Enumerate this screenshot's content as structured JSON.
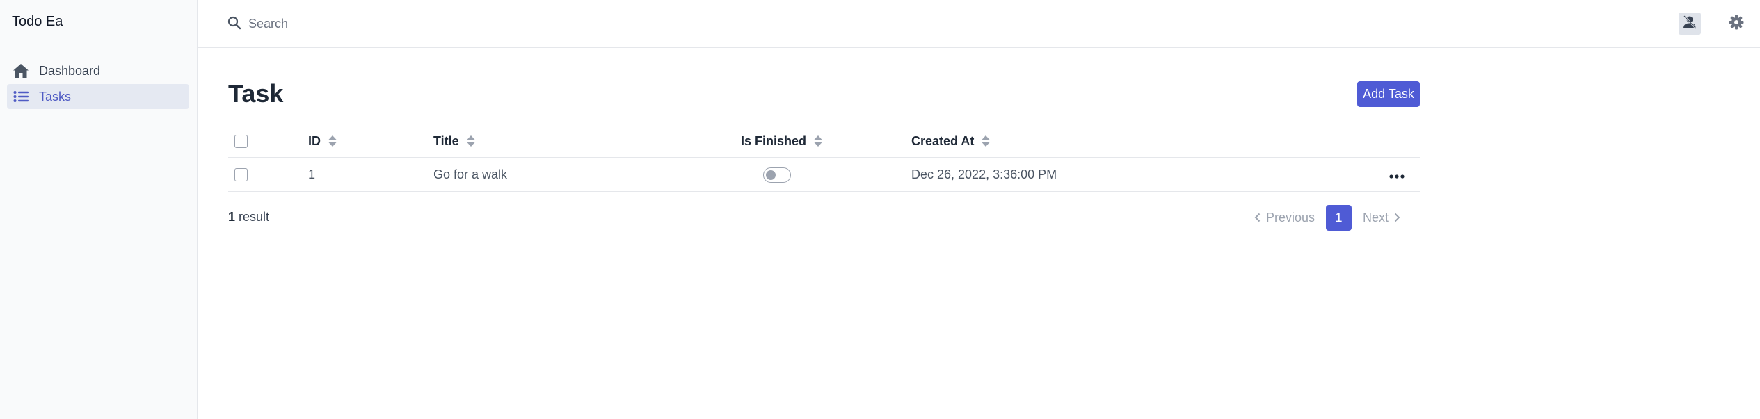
{
  "app": {
    "title": "Todo Ea"
  },
  "sidebar": {
    "items": [
      {
        "label": "Dashboard",
        "icon": "home-icon",
        "active": false
      },
      {
        "label": "Tasks",
        "icon": "list-icon",
        "active": true
      }
    ]
  },
  "topbar": {
    "search_placeholder": "Search",
    "search_value": "",
    "icons": [
      "avatar-icon",
      "gear-icon"
    ]
  },
  "main": {
    "title": "Task",
    "add_button": "Add Task"
  },
  "table": {
    "columns": [
      "ID",
      "Title",
      "Is Finished",
      "Created At"
    ],
    "rows": [
      {
        "id": "1",
        "title": "Go for a walk",
        "is_finished": false,
        "created_at": "Dec 26, 2022, 3:36:00 PM"
      }
    ]
  },
  "footer": {
    "result_count": "1",
    "result_label": "result",
    "previous": "Previous",
    "next": "Next",
    "current_page": "1"
  },
  "colors": {
    "accent": "#4f5bd5",
    "active_nav_bg": "#e5e9f2",
    "active_nav_text": "#4f5bc4"
  }
}
